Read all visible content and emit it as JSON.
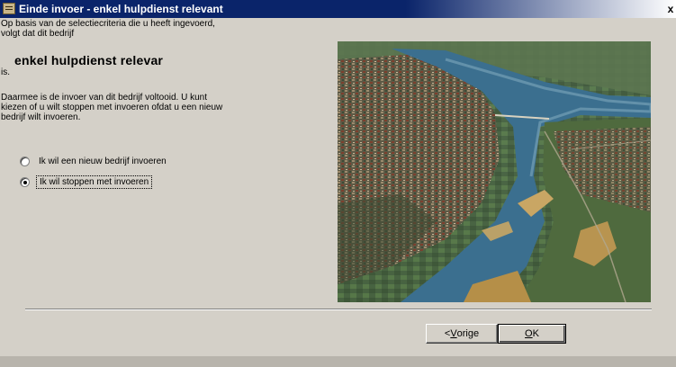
{
  "window": {
    "title": "Einde invoer - enkel hulpdienst relevant",
    "close_glyph": "x"
  },
  "intro": {
    "line1": "Op basis van de selectiecriteria die u heeft ingevoerd,",
    "line2": "volgt dat dit bedrijf"
  },
  "company_status": "enkel hulpdienst relevar",
  "after_company": "is.",
  "done_text": {
    "line1": "Daarmee is de invoer van dit bedrijf voltooid. U kunt",
    "line2": "kiezen of u wilt stoppen met invoeren ofdat u een nieuw",
    "line3": "bedrijf wilt invoeren."
  },
  "options": [
    {
      "label": "Ik wil een nieuw bedrijf invoeren",
      "selected": false
    },
    {
      "label": "Ik wil stoppen met invoeren",
      "selected": true
    }
  ],
  "buttons": {
    "prev_prefix": "< ",
    "prev_accel": "V",
    "prev_rest": "orige",
    "ok_accel": "O",
    "ok_rest": "K"
  },
  "photo": {
    "subject": "aerial view of a city along a wide river"
  },
  "colors": {
    "title_bar": "#0a246a",
    "dialog_bg": "#d4d0c8",
    "river": "#3b6f8f"
  }
}
